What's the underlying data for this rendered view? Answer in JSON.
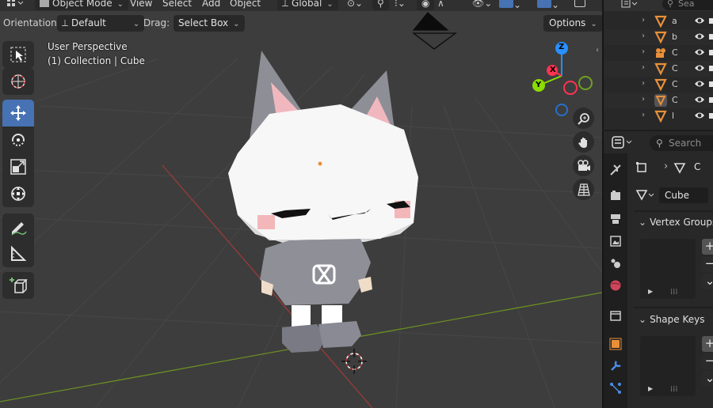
{
  "top_header": {
    "mode": "Object Mode",
    "menus": [
      "View",
      "Select",
      "Add",
      "Object"
    ],
    "transform_orientation": "Global"
  },
  "header2": {
    "orientation_label": "Orientation:",
    "orientation_value": "Default",
    "drag_label": "Drag:",
    "drag_value": "Select Box",
    "options_label": "Options"
  },
  "viewport": {
    "perspective": "User Perspective",
    "collection": "(1) Collection | Cube",
    "gizmo_axes": [
      "Z",
      "X",
      "Y"
    ]
  },
  "toolbar": {
    "tools": [
      {
        "name": "select-box",
        "active": false
      },
      {
        "name": "cursor",
        "active": false
      },
      {
        "name": "move",
        "active": true
      },
      {
        "name": "rotate",
        "active": false
      },
      {
        "name": "scale",
        "active": false
      },
      {
        "name": "transform",
        "active": false
      },
      {
        "name": "annotate",
        "active": false
      },
      {
        "name": "measure",
        "active": false
      },
      {
        "name": "add-cube",
        "active": false
      }
    ]
  },
  "outliner": {
    "search_placeholder": "Sea",
    "items": [
      "a",
      "b",
      "C",
      "C",
      "C",
      "C",
      "l"
    ]
  },
  "properties": {
    "search_placeholder": "Search",
    "breadcrumb_letter": "C",
    "data_name": "Cube",
    "vertex_groups_title": "Vertex Groups",
    "shape_keys_title": "Shape Keys",
    "add_symbol": "+",
    "remove_symbol": "−",
    "chevron_symbol": "⌄"
  },
  "colors": {
    "accent": "#4772b3",
    "axis_x": "#ff3352",
    "axis_y": "#8bdc00",
    "axis_z": "#2890ff",
    "viewport_bg": "#3d3d3d",
    "panel_bg": "#282828",
    "orange_icon": "#e8903a"
  }
}
